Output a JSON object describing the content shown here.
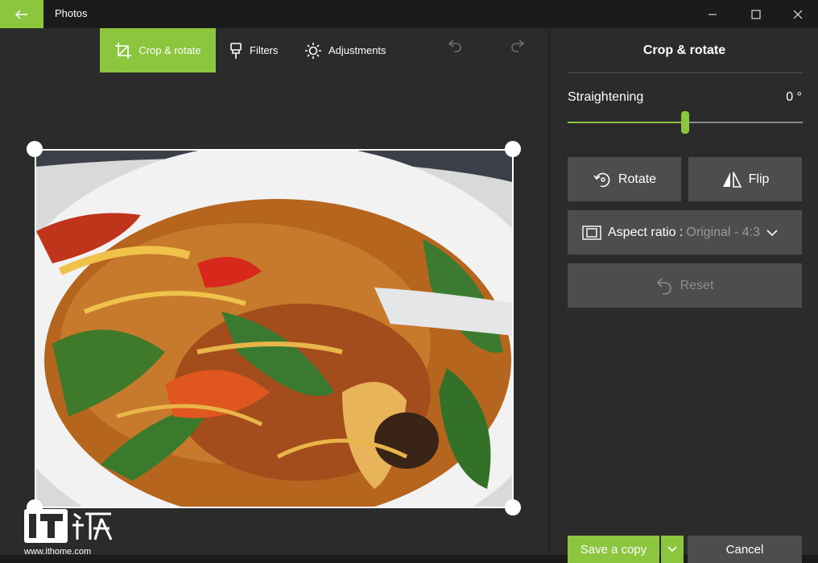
{
  "app": {
    "title": "Photos"
  },
  "toolbar": {
    "crop_label": "Crop & rotate",
    "filters_label": "Filters",
    "adjustments_label": "Adjustments"
  },
  "panel": {
    "title": "Crop & rotate",
    "straightening_label": "Straightening",
    "straightening_value": "0 °",
    "straightening_level": 0.5,
    "rotate_label": "Rotate",
    "flip_label": "Flip",
    "aspect_label": "Aspect ratio :",
    "aspect_value": "Original - 4:3",
    "reset_label": "Reset",
    "save_label": "Save a copy",
    "cancel_label": "Cancel"
  },
  "watermark": {
    "logo_text": "IT之家",
    "url": "www.ithome.com"
  },
  "colors": {
    "accent": "#8cc63f",
    "background": "#2b2b2b",
    "titlebar": "#1b1b1b",
    "button": "#4d4d4d"
  },
  "icons": [
    "back-arrow-icon",
    "minimize-icon",
    "maximize-icon",
    "close-icon",
    "crop-icon",
    "filters-icon",
    "adjustments-icon",
    "undo-icon",
    "redo-icon",
    "rotate-icon",
    "flip-icon",
    "aspect-ratio-icon",
    "reset-icon",
    "chevron-down-icon"
  ]
}
